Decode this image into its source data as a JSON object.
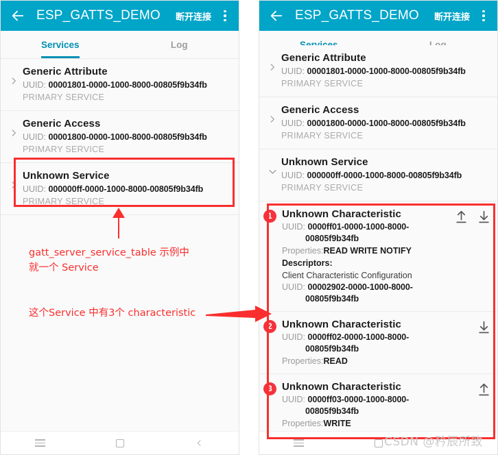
{
  "app": {
    "title": "ESP_GATTS_DEMO",
    "disconnect_label": "断开连接",
    "back_icon": "arrow-left-icon",
    "overflow_icon": "kebab-menu-icon"
  },
  "tabs": [
    {
      "label": "Services",
      "active": true
    },
    {
      "label": "Log",
      "active": false
    }
  ],
  "labels": {
    "uuid_prefix": "UUID: ",
    "properties_prefix": "Properties:",
    "descriptors_heading": "Descriptors:"
  },
  "left_panel": {
    "services": [
      {
        "name": "Generic Attribute",
        "uuid": "00001801-0000-1000-8000-00805f9b34fb",
        "type": "PRIMARY SERVICE",
        "expanded": false,
        "chevron": "chevron-right-icon"
      },
      {
        "name": "Generic Access",
        "uuid": "00001800-0000-1000-8000-00805f9b34fb",
        "type": "PRIMARY SERVICE",
        "expanded": false,
        "chevron": "chevron-right-icon"
      },
      {
        "name": "Unknown Service",
        "uuid": "000000ff-0000-1000-8000-00805f9b34fb",
        "type": "PRIMARY SERVICE",
        "expanded": false,
        "chevron": "chevron-right-icon"
      }
    ]
  },
  "right_panel": {
    "services": [
      {
        "name": "Generic Attribute",
        "uuid": "00001801-0000-1000-8000-00805f9b34fb",
        "type": "PRIMARY SERVICE",
        "expanded": false,
        "chevron": "chevron-right-icon"
      },
      {
        "name": "Generic Access",
        "uuid": "00001800-0000-1000-8000-00805f9b34fb",
        "type": "PRIMARY SERVICE",
        "expanded": false,
        "chevron": "chevron-right-icon"
      },
      {
        "name": "Unknown Service",
        "uuid": "000000ff-0000-1000-8000-00805f9b34fb",
        "type": "PRIMARY SERVICE",
        "expanded": true,
        "chevron": "chevron-down-icon"
      }
    ],
    "characteristics": [
      {
        "index": "1",
        "name": "Unknown Characteristic",
        "uuid_line1": "0000ff01-0000-1000-8000-",
        "uuid_line2": "00805f9b34fb",
        "properties": "READ WRITE NOTIFY",
        "descriptors_heading": "Descriptors:",
        "descriptor_name": "Client Characteristic Configuration",
        "descriptor_uuid_line1": "00002902-0000-1000-8000-",
        "descriptor_uuid_line2": "00805f9b34fb",
        "actions": [
          "upload-icon",
          "download-icon"
        ]
      },
      {
        "index": "2",
        "name": "Unknown Characteristic",
        "uuid_line1": "0000ff02-0000-1000-8000-",
        "uuid_line2": "00805f9b34fb",
        "properties": "READ",
        "actions": [
          "download-icon"
        ]
      },
      {
        "index": "3",
        "name": "Unknown Characteristic",
        "uuid_line1": "0000ff03-0000-1000-8000-",
        "uuid_line2": "00805f9b34fb",
        "properties": "WRITE",
        "actions": [
          "upload-icon"
        ]
      }
    ]
  },
  "navbar": {
    "menu_icon": "hamburger-menu-icon",
    "home_icon": "square-home-icon",
    "back_icon": "chevron-back-icon"
  },
  "annotations": {
    "note_service": "gatt_server_service_table 示例中\n就一个 Service",
    "note_characteristic": "这个Service 中有3个 characteristic"
  },
  "watermark": "CSDN @矜辰所致",
  "colors": {
    "accent_teal": "#00a5c8",
    "tab_active": "#0090b4",
    "annotation_red": "#fa2e2e",
    "badge_red": "#f4333d",
    "panel_bg": "#fafafa"
  }
}
